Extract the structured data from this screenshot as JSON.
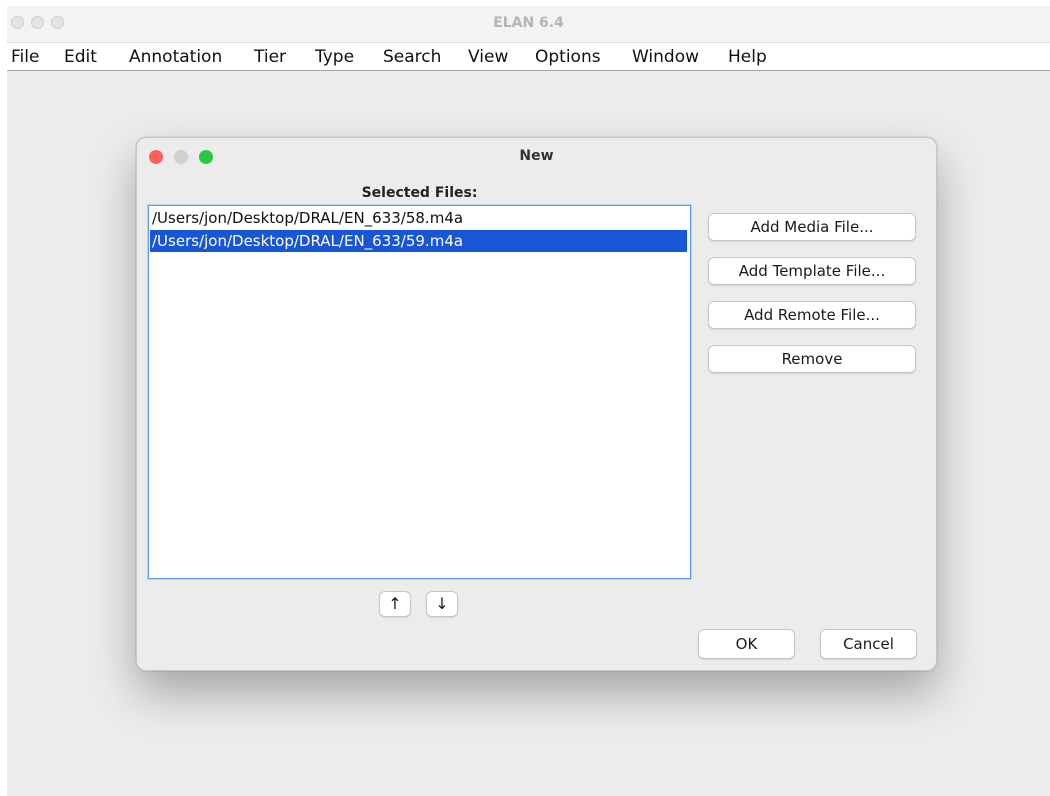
{
  "app": {
    "title": "ELAN 6.4",
    "menu": [
      "File",
      "Edit",
      "Annotation",
      "Tier",
      "Type",
      "Search",
      "View",
      "Options",
      "Window",
      "Help"
    ]
  },
  "dialog": {
    "title": "New",
    "files_label": "Selected Files:",
    "files": [
      {
        "path": "/Users/jon/Desktop/DRAL/EN_633/58.m4a",
        "selected": false
      },
      {
        "path": "/Users/jon/Desktop/DRAL/EN_633/59.m4a",
        "selected": true
      }
    ],
    "buttons": {
      "add_media": "Add Media File...",
      "add_template": "Add Template File...",
      "add_remote": "Add Remote File...",
      "remove": "Remove",
      "move_up": "↑",
      "move_down": "↓",
      "ok": "OK",
      "cancel": "Cancel"
    },
    "colors": {
      "selection": "#1956d6",
      "close": "#fe5f57",
      "minimize": "#d0d0d0",
      "zoom": "#28c840"
    }
  }
}
